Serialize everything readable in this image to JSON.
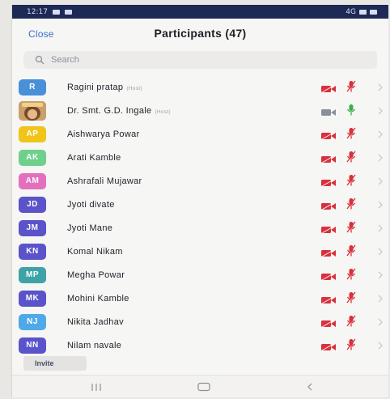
{
  "status_bar": {
    "time": "12:17",
    "right": "4G"
  },
  "header": {
    "close_label": "Close",
    "title": "Participants (47)"
  },
  "search": {
    "placeholder": "Search",
    "icon": "search-icon"
  },
  "participants": [
    {
      "initials": "R",
      "name": "Ragini pratap",
      "role": "(Host)",
      "color": "#4a90d9",
      "video": "off",
      "mic": "muted"
    },
    {
      "initials": "",
      "name": "Dr. Smt. G.D. Ingale",
      "role": "(Host)",
      "color": "#c9a16a",
      "photo": true,
      "video": "on",
      "mic": "active"
    },
    {
      "initials": "AP",
      "name": "Aishwarya Powar",
      "role": "",
      "color": "#f0c419",
      "video": "off",
      "mic": "muted"
    },
    {
      "initials": "AK",
      "name": "Arati Kamble",
      "role": "",
      "color": "#6fd08c",
      "video": "off",
      "mic": "muted"
    },
    {
      "initials": "AM",
      "name": "Ashrafali Mujawar",
      "role": "",
      "color": "#e36fbf",
      "video": "off",
      "mic": "muted"
    },
    {
      "initials": "JD",
      "name": "Jyoti divate",
      "role": "",
      "color": "#5a53c9",
      "video": "off",
      "mic": "muted"
    },
    {
      "initials": "JM",
      "name": "Jyoti Mane",
      "role": "",
      "color": "#5a53c9",
      "video": "off",
      "mic": "muted"
    },
    {
      "initials": "KN",
      "name": "Komal Nikam",
      "role": "",
      "color": "#5a53c9",
      "video": "off",
      "mic": "muted"
    },
    {
      "initials": "MP",
      "name": "Megha Powar",
      "role": "",
      "color": "#3fa3a6",
      "video": "off",
      "mic": "muted"
    },
    {
      "initials": "MK",
      "name": "Mohini Kamble",
      "role": "",
      "color": "#5a53c9",
      "video": "off",
      "mic": "muted"
    },
    {
      "initials": "NJ",
      "name": "Nikita Jadhav",
      "role": "",
      "color": "#4fa9e8",
      "video": "off",
      "mic": "muted"
    },
    {
      "initials": "NN",
      "name": "Nilam navale",
      "role": "",
      "color": "#5a53c9",
      "video": "off",
      "mic": "muted"
    }
  ],
  "footer": {
    "invite_label": "Invite"
  },
  "colors": {
    "accent": "#3a6fd0",
    "muted_red": "#d9303c",
    "active_green": "#3fae49"
  }
}
